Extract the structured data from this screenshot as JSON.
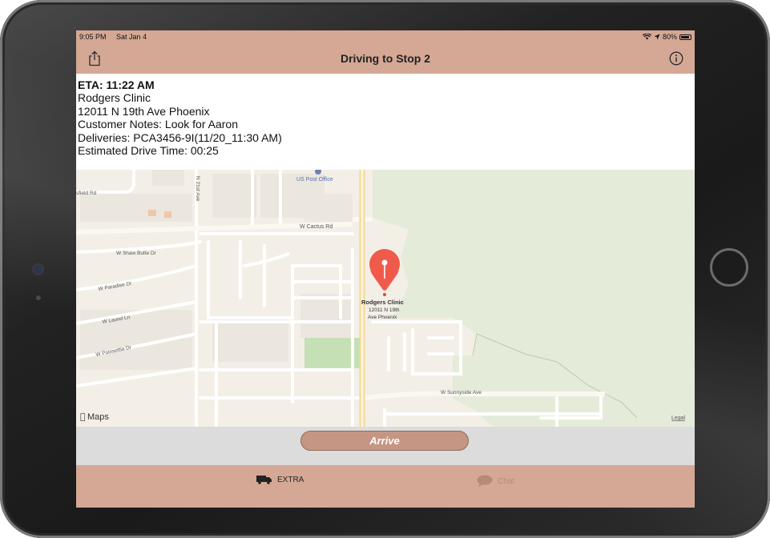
{
  "status_bar": {
    "time": "9:05 PM",
    "date": "Sat Jan 4",
    "battery": "80%"
  },
  "nav": {
    "title": "Driving to Stop 2",
    "share_icon": "share-icon",
    "info_icon": "info-icon"
  },
  "details": {
    "eta": "ETA: 11:22 AM",
    "name": "Rodgers Clinic",
    "address": "12011 N 19th Ave  Phoenix",
    "notes": "Customer Notes: Look for Aaron",
    "deliveries": "Deliveries: PCA3456-9I(11/20_11:30 AM)",
    "drive_time": "Estimated Drive Time: 00:25"
  },
  "map": {
    "pin_title": "Rodgers Clinic",
    "pin_line1": "12011 N 19th",
    "pin_line2": "Ave  Phoenix",
    "poi_post_office": "US Post Office",
    "street_cactus": "W Cactus Rd",
    "street_shaw_butte": "W Shaw Butte Dr",
    "street_paradise": "W Paradise Dr",
    "street_laurel": "W Laurel Ln",
    "street_poinsettia": "W Poinsettia Dr",
    "street_sunnyside": "W Sunnyside Ave",
    "street_21st": "N 21st Ave",
    "street_field": "sfield Rd",
    "attribution": "Maps",
    "legal": "Legal",
    "pin_color": "#f05a4a",
    "park_color": "#e4ecd9"
  },
  "actions": {
    "arrive_label": "Arrive"
  },
  "tabs": {
    "extra_label": "EXTRA",
    "chat_label": "Chat"
  }
}
